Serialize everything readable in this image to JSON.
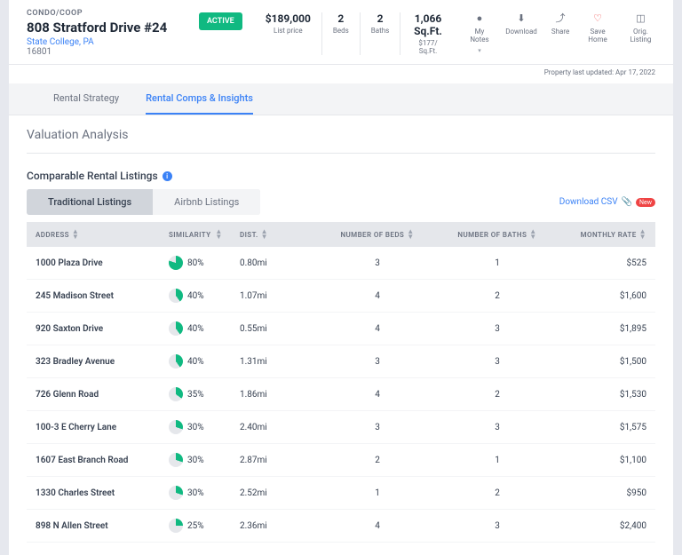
{
  "header": {
    "propType": "CONDO/COOP",
    "address": "808 Stratford Drive #24",
    "city": "State College, PA",
    "zip": "16801",
    "status": "ACTIVE",
    "stats": {
      "price": {
        "v": "$189,000",
        "l": "List price"
      },
      "beds": {
        "v": "2",
        "l": "Beds"
      },
      "baths": {
        "v": "2",
        "l": "Baths"
      },
      "sqft": {
        "v": "1,066 Sq.Ft.",
        "l": "$177/ Sq.Ft."
      }
    },
    "actions": {
      "notes": "My Notes",
      "download": "Download",
      "share": "Share",
      "save": "Save Home",
      "orig": "Orig. Listing"
    },
    "updated": "Property last updated: Apr 17, 2022"
  },
  "tabs": {
    "rental": "Rental Strategy",
    "comps": "Rental Comps & Insights"
  },
  "content": {
    "sectionTitle": "Valuation Analysis",
    "subTitle": "Comparable Rental Listings",
    "ltabs": {
      "trad": "Traditional Listings",
      "airbnb": "Airbnb Listings"
    },
    "csv": "Download CSV",
    "csvBadge": "New",
    "cols": {
      "addr": "ADDRESS",
      "sim": "SIMILARITY",
      "dist": "DIST.",
      "beds": "NUMBER OF BEDS",
      "baths": "NUMBER OF BATHS",
      "rate": "MONTHLY RATE"
    },
    "rows": [
      {
        "addr": "1000 Plaza Drive",
        "sim": "80%",
        "p": 80,
        "dist": "0.80mi",
        "beds": "3",
        "baths": "1",
        "rate": "$525"
      },
      {
        "addr": "245 Madison Street",
        "sim": "40%",
        "p": 40,
        "dist": "1.07mi",
        "beds": "4",
        "baths": "2",
        "rate": "$1,600"
      },
      {
        "addr": "920 Saxton Drive",
        "sim": "40%",
        "p": 40,
        "dist": "0.55mi",
        "beds": "4",
        "baths": "3",
        "rate": "$1,895"
      },
      {
        "addr": "323 Bradley Avenue",
        "sim": "40%",
        "p": 40,
        "dist": "1.31mi",
        "beds": "3",
        "baths": "3",
        "rate": "$1,500"
      },
      {
        "addr": "726 Glenn Road",
        "sim": "35%",
        "p": 35,
        "dist": "1.86mi",
        "beds": "4",
        "baths": "2",
        "rate": "$1,530"
      },
      {
        "addr": "100-3 E Cherry Lane",
        "sim": "30%",
        "p": 30,
        "dist": "2.40mi",
        "beds": "3",
        "baths": "3",
        "rate": "$1,575"
      },
      {
        "addr": "1607 East Branch Road",
        "sim": "30%",
        "p": 30,
        "dist": "2.87mi",
        "beds": "2",
        "baths": "1",
        "rate": "$1,100"
      },
      {
        "addr": "1330 Charles Street",
        "sim": "30%",
        "p": 30,
        "dist": "2.52mi",
        "beds": "1",
        "baths": "2",
        "rate": "$950"
      },
      {
        "addr": "898 N Allen Street",
        "sim": "25%",
        "p": 25,
        "dist": "2.36mi",
        "beds": "4",
        "baths": "3",
        "rate": "$2,400"
      }
    ]
  }
}
